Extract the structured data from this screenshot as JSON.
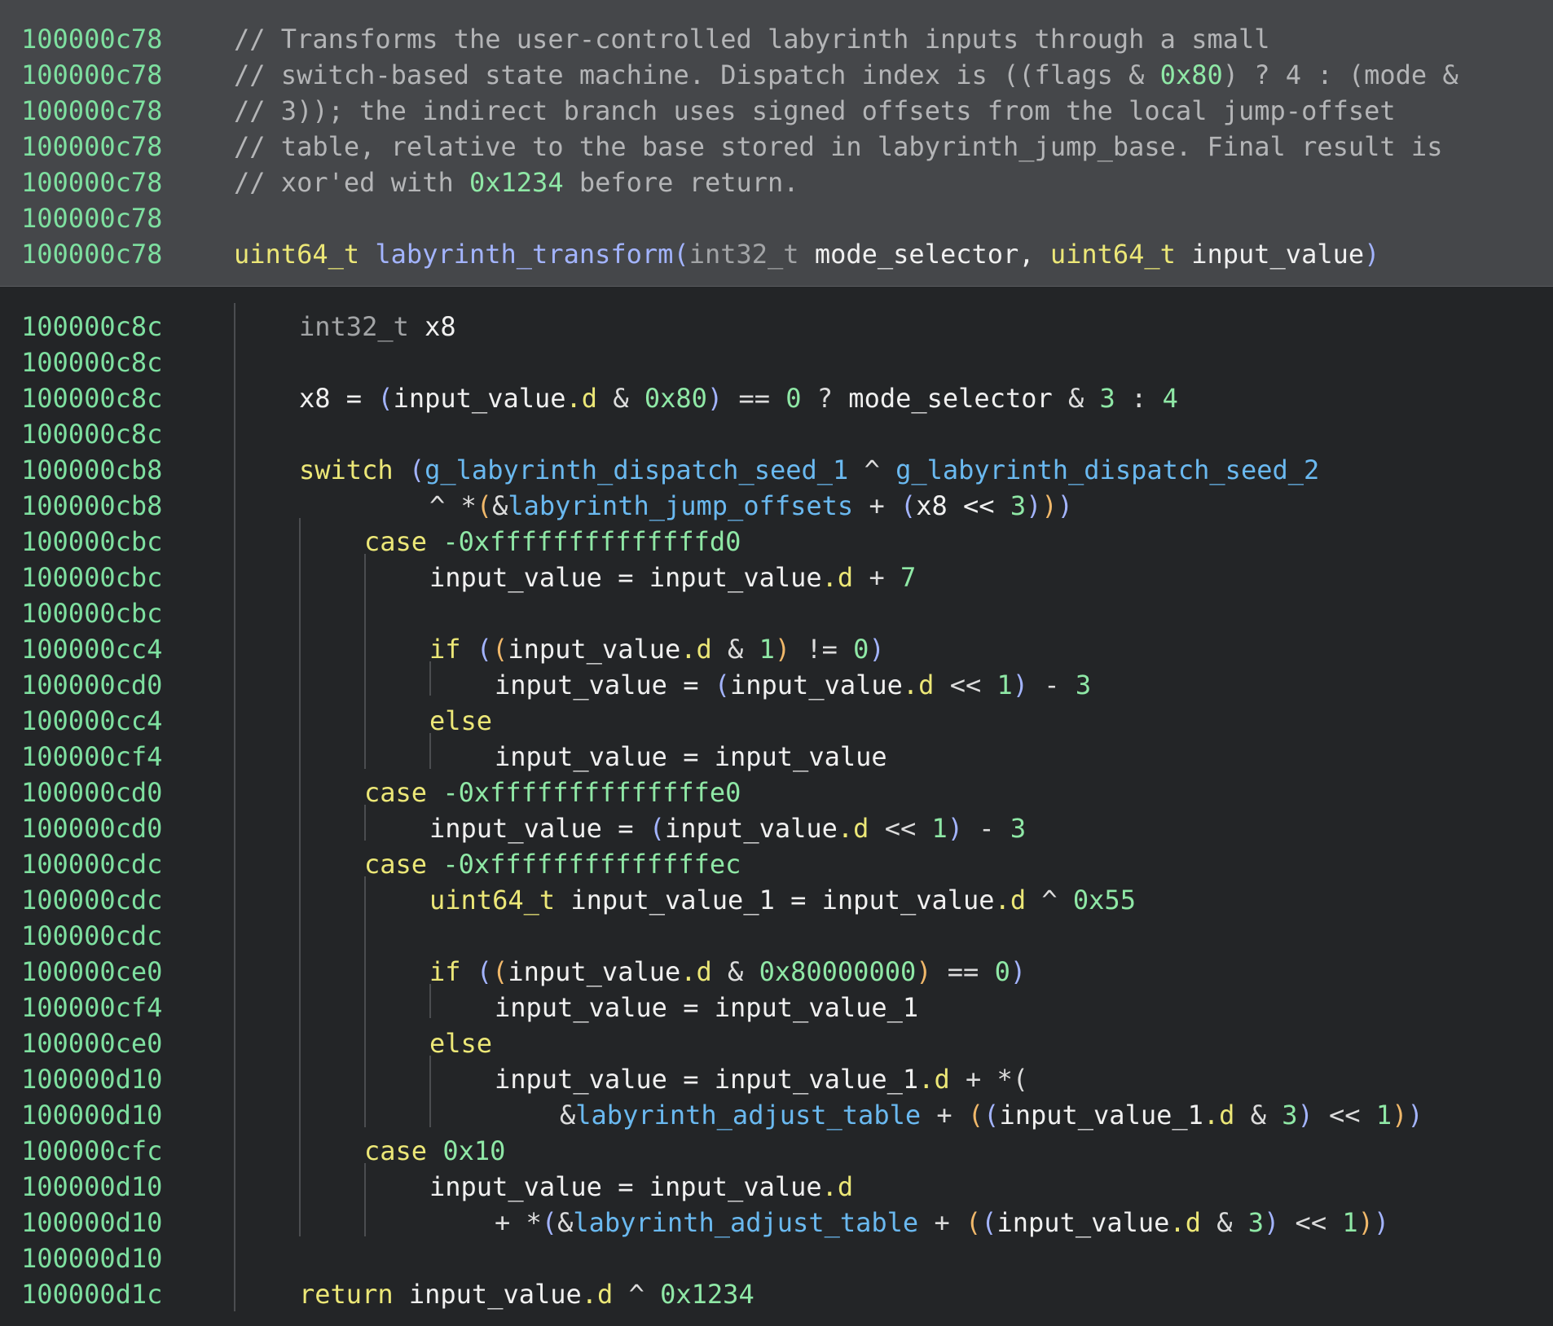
{
  "colors": {
    "header_bg": "#45474a",
    "body_bg": "#232527",
    "address": "#7ee0a0",
    "keyword": "#ece777",
    "function": "#a3b4ff",
    "global": "#6ab9f0",
    "number": "#8fe8a6",
    "comment": "#b4b5b7",
    "paren_outer": "#a3b4ff",
    "paren_inner": "#f0b86a"
  },
  "lines": [
    {
      "addr": "100000c78",
      "tokens": [
        [
          "cmt",
          "// Transforms the user-controlled labyrinth inputs through a small"
        ]
      ]
    },
    {
      "addr": "100000c78",
      "tokens": [
        [
          "cmt",
          "// switch-based state machine. Dispatch index is ((flags & "
        ],
        [
          "num",
          "0x80"
        ],
        [
          "cmt",
          ") ? 4 : (mode &"
        ]
      ]
    },
    {
      "addr": "100000c78",
      "tokens": [
        [
          "cmt",
          "// 3)); the indirect branch uses signed offsets from the local jump-offset"
        ]
      ]
    },
    {
      "addr": "100000c78",
      "tokens": [
        [
          "cmt",
          "// table, relative to the base stored in labyrinth_jump_base. Final result is"
        ]
      ]
    },
    {
      "addr": "100000c78",
      "tokens": [
        [
          "cmt",
          "// xor'ed with "
        ],
        [
          "num",
          "0x1234"
        ],
        [
          "cmt",
          " before return."
        ]
      ]
    },
    {
      "addr": "100000c78",
      "tokens": []
    },
    {
      "addr": "100000c78",
      "tokens": [
        [
          "type",
          "uint64_t"
        ],
        [
          "op",
          " "
        ],
        [
          "fn",
          "labyrinth_transform"
        ],
        [
          "p1",
          "("
        ],
        [
          "dtype",
          "int32_t"
        ],
        [
          "var",
          " mode_selector, "
        ],
        [
          "type",
          "uint64_t"
        ],
        [
          "var",
          " input_value"
        ],
        [
          "p1",
          ")"
        ]
      ]
    },
    {
      "addr": "100000c8c",
      "tokens": [
        [
          "dtype",
          "int32_t"
        ],
        [
          "var",
          " x8"
        ]
      ]
    },
    {
      "addr": "100000c8c",
      "tokens": []
    },
    {
      "addr": "100000c8c",
      "tokens": [
        [
          "var",
          "x8 = "
        ],
        [
          "p1",
          "("
        ],
        [
          "var",
          "input_value"
        ],
        [
          "fld",
          ".d"
        ],
        [
          "op",
          " & "
        ],
        [
          "num",
          "0x80"
        ],
        [
          "p1",
          ")"
        ],
        [
          "op",
          " == "
        ],
        [
          "num",
          "0"
        ],
        [
          "op",
          " ? "
        ],
        [
          "var",
          "mode_selector"
        ],
        [
          "op",
          " & "
        ],
        [
          "num",
          "3"
        ],
        [
          "op",
          " : "
        ],
        [
          "num",
          "4"
        ]
      ]
    },
    {
      "addr": "100000c8c",
      "tokens": []
    },
    {
      "addr": "100000cb8",
      "tokens": [
        [
          "kw",
          "switch"
        ],
        [
          "op",
          " "
        ],
        [
          "p1",
          "("
        ],
        [
          "gv",
          "g_labyrinth_dispatch_seed_1"
        ],
        [
          "op",
          " ^ "
        ],
        [
          "gv",
          "g_labyrinth_dispatch_seed_2"
        ]
      ]
    },
    {
      "addr": "100000cb8",
      "tokens": [
        [
          "op",
          "^ *"
        ],
        [
          "p2",
          "("
        ],
        [
          "op",
          "&"
        ],
        [
          "gv",
          "labyrinth_jump_offsets"
        ],
        [
          "op",
          " + "
        ],
        [
          "p1",
          "("
        ],
        [
          "var",
          "x8 << "
        ],
        [
          "num",
          "3"
        ],
        [
          "p1",
          ")"
        ],
        [
          "p2",
          ")"
        ],
        [
          "p1",
          ")"
        ]
      ]
    },
    {
      "addr": "100000cbc",
      "tokens": [
        [
          "kw",
          "case"
        ],
        [
          "op",
          " "
        ],
        [
          "num",
          "-0xffffffffffffffd0"
        ]
      ]
    },
    {
      "addr": "100000cbc",
      "tokens": [
        [
          "var",
          "input_value = input_value"
        ],
        [
          "fld",
          ".d"
        ],
        [
          "op",
          " + "
        ],
        [
          "num",
          "7"
        ]
      ]
    },
    {
      "addr": "100000cbc",
      "tokens": []
    },
    {
      "addr": "100000cc4",
      "tokens": [
        [
          "kw",
          "if"
        ],
        [
          "op",
          " "
        ],
        [
          "p1",
          "("
        ],
        [
          "p2",
          "("
        ],
        [
          "var",
          "input_value"
        ],
        [
          "fld",
          ".d"
        ],
        [
          "op",
          " & "
        ],
        [
          "num",
          "1"
        ],
        [
          "p2",
          ")"
        ],
        [
          "op",
          " != "
        ],
        [
          "num",
          "0"
        ],
        [
          "p1",
          ")"
        ]
      ]
    },
    {
      "addr": "100000cd0",
      "tokens": [
        [
          "var",
          "input_value = "
        ],
        [
          "p1",
          "("
        ],
        [
          "var",
          "input_value"
        ],
        [
          "fld",
          ".d"
        ],
        [
          "op",
          " << "
        ],
        [
          "num",
          "1"
        ],
        [
          "p1",
          ")"
        ],
        [
          "op",
          " - "
        ],
        [
          "num",
          "3"
        ]
      ]
    },
    {
      "addr": "100000cc4",
      "tokens": [
        [
          "kw",
          "else"
        ]
      ]
    },
    {
      "addr": "100000cf4",
      "tokens": [
        [
          "var",
          "input_value = input_value"
        ]
      ]
    },
    {
      "addr": "100000cd0",
      "tokens": [
        [
          "kw",
          "case"
        ],
        [
          "op",
          " "
        ],
        [
          "num",
          "-0xffffffffffffffe0"
        ]
      ]
    },
    {
      "addr": "100000cd0",
      "tokens": [
        [
          "var",
          "input_value = "
        ],
        [
          "p1",
          "("
        ],
        [
          "var",
          "input_value"
        ],
        [
          "fld",
          ".d"
        ],
        [
          "op",
          " << "
        ],
        [
          "num",
          "1"
        ],
        [
          "p1",
          ")"
        ],
        [
          "op",
          " - "
        ],
        [
          "num",
          "3"
        ]
      ]
    },
    {
      "addr": "100000cdc",
      "tokens": [
        [
          "kw",
          "case"
        ],
        [
          "op",
          " "
        ],
        [
          "num",
          "-0xffffffffffffffec"
        ]
      ]
    },
    {
      "addr": "100000cdc",
      "tokens": [
        [
          "type",
          "uint64_t"
        ],
        [
          "var",
          " input_value_1 = input_value"
        ],
        [
          "fld",
          ".d"
        ],
        [
          "op",
          " ^ "
        ],
        [
          "num",
          "0x55"
        ]
      ]
    },
    {
      "addr": "100000cdc",
      "tokens": []
    },
    {
      "addr": "100000ce0",
      "tokens": [
        [
          "kw",
          "if"
        ],
        [
          "op",
          " "
        ],
        [
          "p1",
          "("
        ],
        [
          "p2",
          "("
        ],
        [
          "var",
          "input_value"
        ],
        [
          "fld",
          ".d"
        ],
        [
          "op",
          " & "
        ],
        [
          "num",
          "0x80000000"
        ],
        [
          "p2",
          ")"
        ],
        [
          "op",
          " == "
        ],
        [
          "num",
          "0"
        ],
        [
          "p1",
          ")"
        ]
      ]
    },
    {
      "addr": "100000cf4",
      "tokens": [
        [
          "var",
          "input_value = input_value_1"
        ]
      ]
    },
    {
      "addr": "100000ce0",
      "tokens": [
        [
          "kw",
          "else"
        ]
      ]
    },
    {
      "addr": "100000d10",
      "tokens": [
        [
          "var",
          "input_value = input_value_1"
        ],
        [
          "fld",
          ".d"
        ],
        [
          "op",
          " + *("
        ]
      ]
    },
    {
      "addr": "100000d10",
      "tokens": [
        [
          "op",
          "&"
        ],
        [
          "gv",
          "labyrinth_adjust_table"
        ],
        [
          "op",
          " + "
        ],
        [
          "p2",
          "("
        ],
        [
          "p1",
          "("
        ],
        [
          "var",
          "input_value_1"
        ],
        [
          "fld",
          ".d"
        ],
        [
          "op",
          " & "
        ],
        [
          "num",
          "3"
        ],
        [
          "p1",
          ")"
        ],
        [
          "op",
          " << "
        ],
        [
          "num",
          "1"
        ],
        [
          "p2",
          ")"
        ],
        [
          "p1",
          ")"
        ]
      ]
    },
    {
      "addr": "100000cfc",
      "tokens": [
        [
          "kw",
          "case"
        ],
        [
          "op",
          " "
        ],
        [
          "num",
          "0x10"
        ]
      ]
    },
    {
      "addr": "100000d10",
      "tokens": [
        [
          "var",
          "input_value = input_value"
        ],
        [
          "fld",
          ".d"
        ]
      ]
    },
    {
      "addr": "100000d10",
      "tokens": [
        [
          "op",
          "+ *"
        ],
        [
          "p1",
          "("
        ],
        [
          "op",
          "&"
        ],
        [
          "gv",
          "labyrinth_adjust_table"
        ],
        [
          "op",
          " + "
        ],
        [
          "p2",
          "("
        ],
        [
          "p1",
          "("
        ],
        [
          "var",
          "input_value"
        ],
        [
          "fld",
          ".d"
        ],
        [
          "op",
          " & "
        ],
        [
          "num",
          "3"
        ],
        [
          "p1",
          ")"
        ],
        [
          "op",
          " << "
        ],
        [
          "num",
          "1"
        ],
        [
          "p2",
          ")"
        ],
        [
          "p1",
          ")"
        ]
      ]
    },
    {
      "addr": "100000d10",
      "tokens": []
    },
    {
      "addr": "100000d1c",
      "tokens": [
        [
          "kw",
          "return"
        ],
        [
          "var",
          " input_value"
        ],
        [
          "fld",
          ".d"
        ],
        [
          "op",
          " ^ "
        ],
        [
          "num",
          "0x1234"
        ]
      ]
    }
  ]
}
